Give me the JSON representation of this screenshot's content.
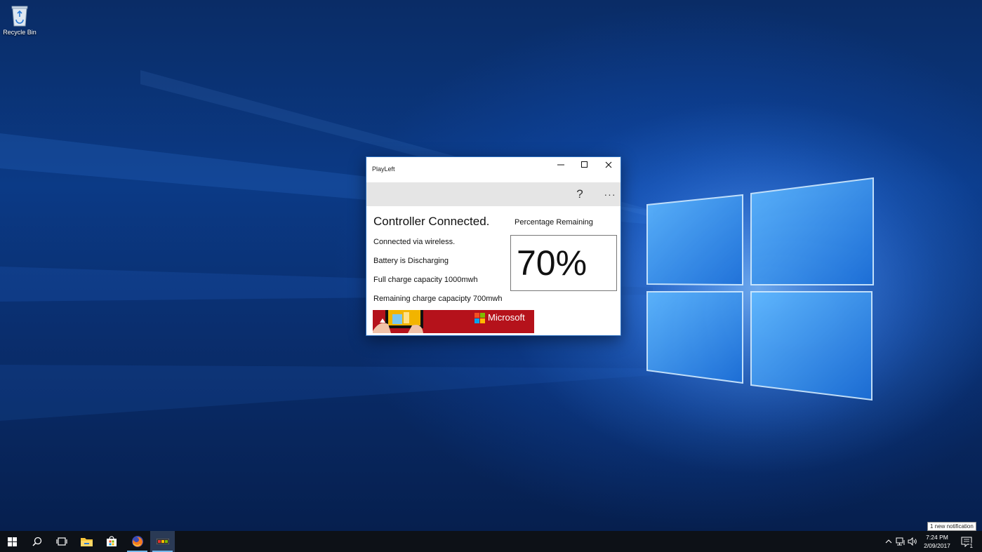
{
  "desktop": {
    "icons": [
      {
        "label": "Recycle Bin",
        "icon": "recycle-bin-icon"
      }
    ]
  },
  "window": {
    "title": "PlayLeft",
    "controls": {
      "minimize": "minimize-icon",
      "maximize": "maximize-icon",
      "close": "close-icon"
    },
    "appbar": {
      "help_label": "?",
      "more_label": "···"
    },
    "heading": "Controller Connected.",
    "info_lines": [
      "Connected via wireless.",
      "Battery is Discharging",
      "Full charge capacity 1000mwh",
      "Remaining charge capacipty 700mwh"
    ],
    "percentage_label": "Percentage Remaining",
    "percentage_value": "70%",
    "ad": {
      "brand": "Microsoft",
      "color": "#b5121b"
    }
  },
  "notification_tooltip": "1 new notification",
  "taskbar": {
    "buttons": [
      {
        "name": "start-button",
        "icon": "windows-logo-icon"
      },
      {
        "name": "search-button",
        "icon": "search-icon"
      },
      {
        "name": "task-view-button",
        "icon": "task-view-icon"
      },
      {
        "name": "file-explorer-button",
        "icon": "folder-icon"
      },
      {
        "name": "store-button",
        "icon": "store-icon"
      },
      {
        "name": "firefox-button",
        "icon": "firefox-icon"
      },
      {
        "name": "playleft-button",
        "icon": "playleft-app-icon"
      }
    ],
    "tray": {
      "icons": [
        "chevron-up-icon",
        "network-icon",
        "volume-icon"
      ],
      "time": "7:24 PM",
      "date": "2/09/2017",
      "notification_count": "1"
    }
  }
}
